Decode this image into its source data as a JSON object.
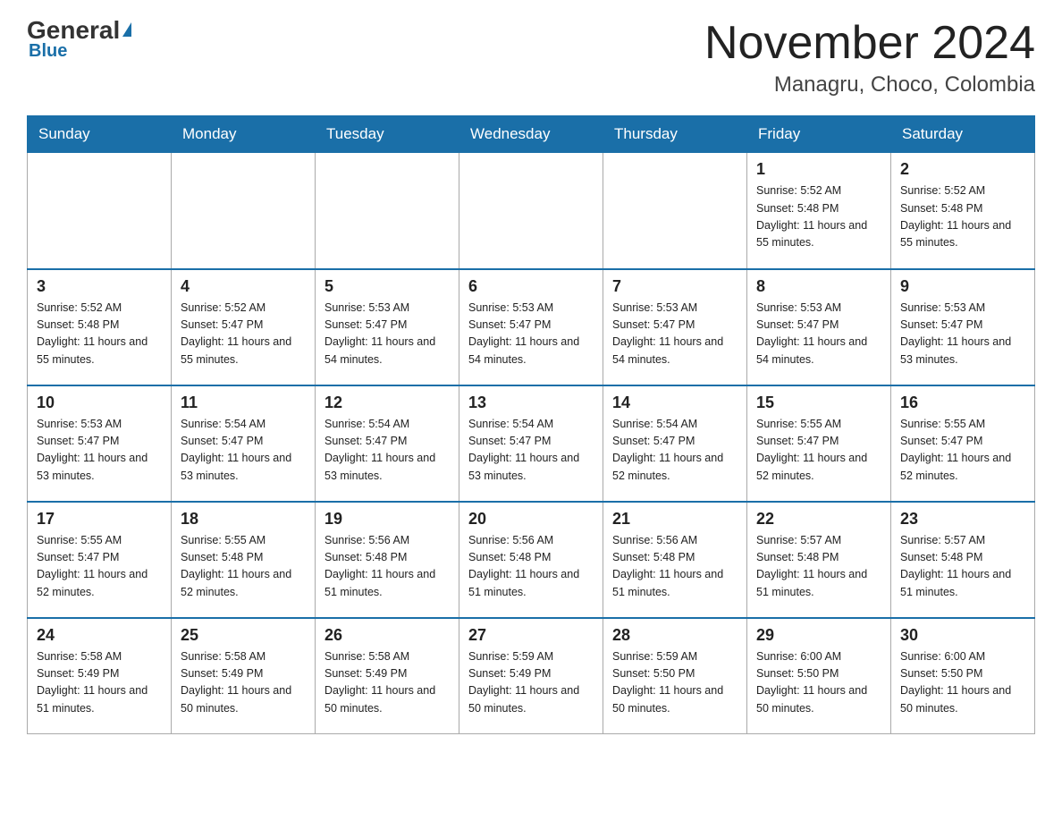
{
  "header": {
    "logo_general": "General",
    "logo_blue": "Blue",
    "title": "November 2024",
    "subtitle": "Managru, Choco, Colombia"
  },
  "calendar": {
    "days_of_week": [
      "Sunday",
      "Monday",
      "Tuesday",
      "Wednesday",
      "Thursday",
      "Friday",
      "Saturday"
    ],
    "weeks": [
      [
        {
          "day": "",
          "info": ""
        },
        {
          "day": "",
          "info": ""
        },
        {
          "day": "",
          "info": ""
        },
        {
          "day": "",
          "info": ""
        },
        {
          "day": "",
          "info": ""
        },
        {
          "day": "1",
          "info": "Sunrise: 5:52 AM\nSunset: 5:48 PM\nDaylight: 11 hours and 55 minutes."
        },
        {
          "day": "2",
          "info": "Sunrise: 5:52 AM\nSunset: 5:48 PM\nDaylight: 11 hours and 55 minutes."
        }
      ],
      [
        {
          "day": "3",
          "info": "Sunrise: 5:52 AM\nSunset: 5:48 PM\nDaylight: 11 hours and 55 minutes."
        },
        {
          "day": "4",
          "info": "Sunrise: 5:52 AM\nSunset: 5:47 PM\nDaylight: 11 hours and 55 minutes."
        },
        {
          "day": "5",
          "info": "Sunrise: 5:53 AM\nSunset: 5:47 PM\nDaylight: 11 hours and 54 minutes."
        },
        {
          "day": "6",
          "info": "Sunrise: 5:53 AM\nSunset: 5:47 PM\nDaylight: 11 hours and 54 minutes."
        },
        {
          "day": "7",
          "info": "Sunrise: 5:53 AM\nSunset: 5:47 PM\nDaylight: 11 hours and 54 minutes."
        },
        {
          "day": "8",
          "info": "Sunrise: 5:53 AM\nSunset: 5:47 PM\nDaylight: 11 hours and 54 minutes."
        },
        {
          "day": "9",
          "info": "Sunrise: 5:53 AM\nSunset: 5:47 PM\nDaylight: 11 hours and 53 minutes."
        }
      ],
      [
        {
          "day": "10",
          "info": "Sunrise: 5:53 AM\nSunset: 5:47 PM\nDaylight: 11 hours and 53 minutes."
        },
        {
          "day": "11",
          "info": "Sunrise: 5:54 AM\nSunset: 5:47 PM\nDaylight: 11 hours and 53 minutes."
        },
        {
          "day": "12",
          "info": "Sunrise: 5:54 AM\nSunset: 5:47 PM\nDaylight: 11 hours and 53 minutes."
        },
        {
          "day": "13",
          "info": "Sunrise: 5:54 AM\nSunset: 5:47 PM\nDaylight: 11 hours and 53 minutes."
        },
        {
          "day": "14",
          "info": "Sunrise: 5:54 AM\nSunset: 5:47 PM\nDaylight: 11 hours and 52 minutes."
        },
        {
          "day": "15",
          "info": "Sunrise: 5:55 AM\nSunset: 5:47 PM\nDaylight: 11 hours and 52 minutes."
        },
        {
          "day": "16",
          "info": "Sunrise: 5:55 AM\nSunset: 5:47 PM\nDaylight: 11 hours and 52 minutes."
        }
      ],
      [
        {
          "day": "17",
          "info": "Sunrise: 5:55 AM\nSunset: 5:47 PM\nDaylight: 11 hours and 52 minutes."
        },
        {
          "day": "18",
          "info": "Sunrise: 5:55 AM\nSunset: 5:48 PM\nDaylight: 11 hours and 52 minutes."
        },
        {
          "day": "19",
          "info": "Sunrise: 5:56 AM\nSunset: 5:48 PM\nDaylight: 11 hours and 51 minutes."
        },
        {
          "day": "20",
          "info": "Sunrise: 5:56 AM\nSunset: 5:48 PM\nDaylight: 11 hours and 51 minutes."
        },
        {
          "day": "21",
          "info": "Sunrise: 5:56 AM\nSunset: 5:48 PM\nDaylight: 11 hours and 51 minutes."
        },
        {
          "day": "22",
          "info": "Sunrise: 5:57 AM\nSunset: 5:48 PM\nDaylight: 11 hours and 51 minutes."
        },
        {
          "day": "23",
          "info": "Sunrise: 5:57 AM\nSunset: 5:48 PM\nDaylight: 11 hours and 51 minutes."
        }
      ],
      [
        {
          "day": "24",
          "info": "Sunrise: 5:58 AM\nSunset: 5:49 PM\nDaylight: 11 hours and 51 minutes."
        },
        {
          "day": "25",
          "info": "Sunrise: 5:58 AM\nSunset: 5:49 PM\nDaylight: 11 hours and 50 minutes."
        },
        {
          "day": "26",
          "info": "Sunrise: 5:58 AM\nSunset: 5:49 PM\nDaylight: 11 hours and 50 minutes."
        },
        {
          "day": "27",
          "info": "Sunrise: 5:59 AM\nSunset: 5:49 PM\nDaylight: 11 hours and 50 minutes."
        },
        {
          "day": "28",
          "info": "Sunrise: 5:59 AM\nSunset: 5:50 PM\nDaylight: 11 hours and 50 minutes."
        },
        {
          "day": "29",
          "info": "Sunrise: 6:00 AM\nSunset: 5:50 PM\nDaylight: 11 hours and 50 minutes."
        },
        {
          "day": "30",
          "info": "Sunrise: 6:00 AM\nSunset: 5:50 PM\nDaylight: 11 hours and 50 minutes."
        }
      ]
    ]
  }
}
